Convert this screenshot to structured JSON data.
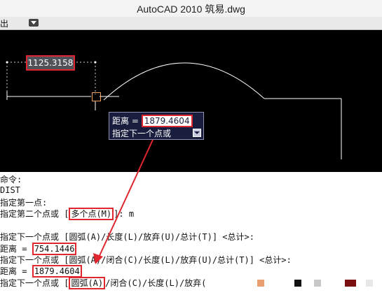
{
  "window": {
    "title": "AutoCAD 2010      筑易.dwg"
  },
  "menubar": {
    "item_label": "出"
  },
  "canvas": {
    "dimension_value": "1125.3158",
    "tooltip": {
      "prefix": "距离 = ",
      "value": "1879.4604",
      "prompt": "指定下一个点或"
    }
  },
  "history": {
    "l1": "命令:",
    "l2": "DIST",
    "l3": "指定第一点:",
    "l4a": "指定第二个点或 [",
    "l4b": "多个点(M)",
    "l4c": "]: m",
    "l5": "指定下一个点或 [圆弧(A)/长度(L)/放弃(U)/总计(T)] <总计>:",
    "l6a": "距离 = ",
    "l6b": "754.1446",
    "l7": "指定下一个点或 [圆弧(A)/闭合(C)/长度(L)/放弃(U)/总计(T)] <总计>:",
    "l8a": "距离 = ",
    "l8b": "1879.4604",
    "l9a": "指定下一个点或 [",
    "l9b": "圆弧(A)",
    "l9c": "/闭合(C)/长度(L)/放弃("
  },
  "colors": {
    "canvas_bg": "#000000",
    "highlight": "#e0262e",
    "tooltip_bg": "#1a1e3e"
  }
}
